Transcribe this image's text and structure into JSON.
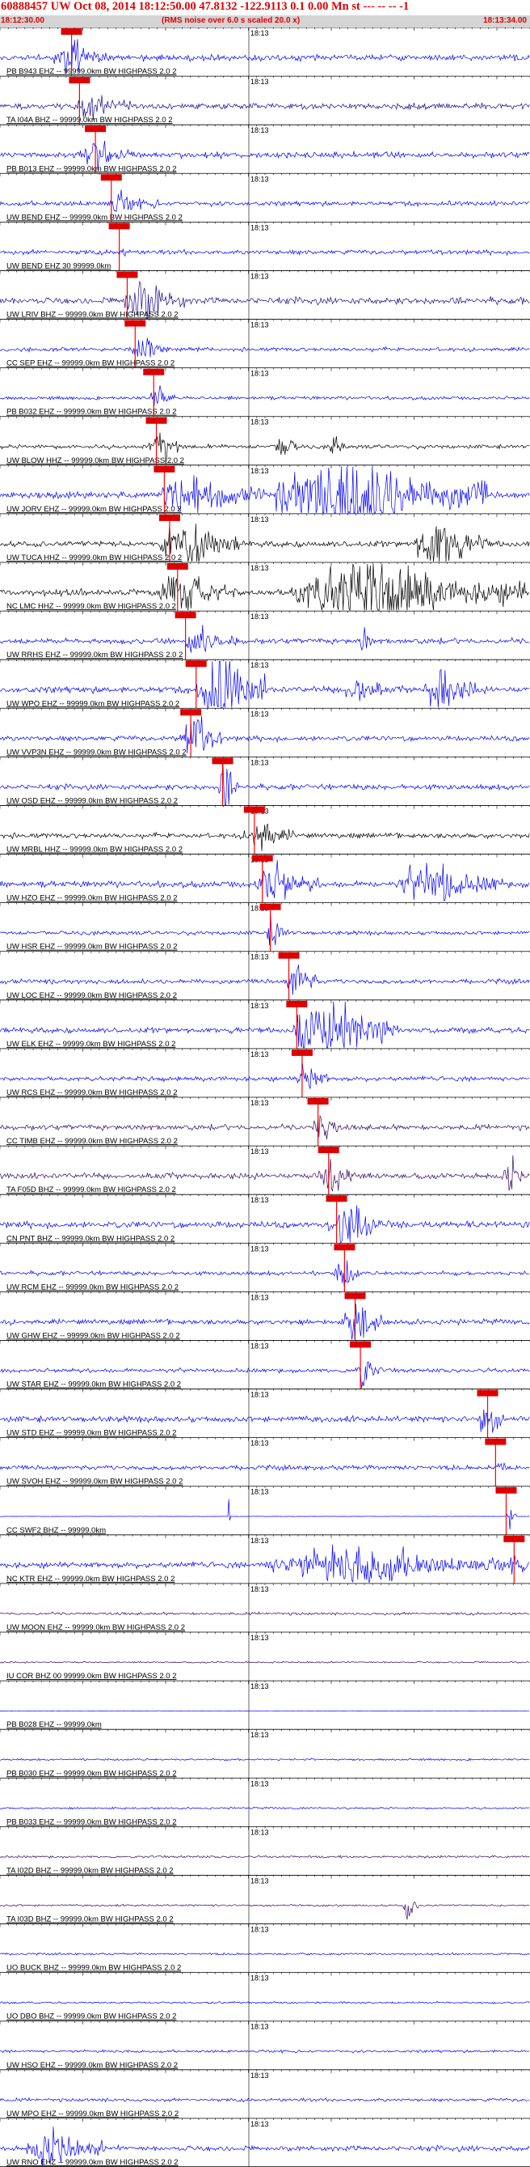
{
  "header": {
    "title": "60888457 UW Oct 08, 2014 18:12:50.00   47.8132 -122.9113  0.1 0.00 Mn st --- -- -- -1",
    "start_time": "18:12:30.00",
    "note": "(RMS noise over 6.0 s scaled 20.0 x)",
    "end_time": "18:13:34.00"
  },
  "colors": {
    "title": "#e00000",
    "pick_box": "#dd0000",
    "pick_line": "#ff0000",
    "blue": "#0000ff",
    "navy": "#1a0a8c",
    "black": "#000000",
    "purple": "#330a66",
    "subbar": "#d4d4d4"
  },
  "chart_data": {
    "type": "line",
    "title": "60888457 UW Oct 08, 2014 18:12:50.00   47.8132 -122.9113  0.1 0.00 Mn st --- -- -- -1",
    "x_range": [
      "18:12:30.00",
      "18:13:34.00"
    ],
    "minute_mark": "18:13",
    "traces": [
      {
        "label": "PB B943 EHZ -- 99999.0km BW  HIGHPASS  2.0  2",
        "color": "blue",
        "pick": 0.135,
        "amp": 0.9,
        "envelope": [
          [
            0.1,
            0.2,
            1.0
          ]
        ]
      },
      {
        "label": "TA I04A BHZ -- 99999.0km BW  HIGHPASS  2.0  2",
        "color": "navy",
        "pick": 0.15,
        "amp": 0.9,
        "envelope": [
          [
            0.14,
            0.25,
            0.7
          ]
        ]
      },
      {
        "label": "PB B013 EHZ -- 99999.0km BW  HIGHPASS  2.0  2",
        "color": "blue",
        "pick": 0.18,
        "amp": 0.9,
        "envelope": [
          [
            0.14,
            0.25,
            0.9
          ]
        ]
      },
      {
        "label": "UW BEND EHZ -- 99999.0km BW  HIGHPASS  2.0  2",
        "color": "blue",
        "pick": 0.21,
        "amp": 0.7,
        "envelope": [
          [
            0.2,
            0.3,
            0.5
          ]
        ]
      },
      {
        "label": "UW BEND EHZ 30 99999.0km",
        "color": "blue",
        "pick": 0.225,
        "amp": 0.7,
        "envelope": []
      },
      {
        "label": "UW LRIV BHZ -- 99999.0km BW  HIGHPASS  2.0  2",
        "color": "navy",
        "pick": 0.24,
        "amp": 1.0,
        "envelope": [
          [
            0.23,
            0.35,
            1.6
          ]
        ]
      },
      {
        "label": "CC SEP EHZ -- 99999.0km BW  HIGHPASS  2.0  2",
        "color": "blue",
        "pick": 0.255,
        "amp": 0.6,
        "envelope": [
          [
            0.25,
            0.32,
            0.8
          ]
        ]
      },
      {
        "label": "PB B032 EHZ -- 99999.0km BW  HIGHPASS  2.0  2",
        "color": "blue",
        "pick": 0.29,
        "amp": 0.5,
        "envelope": [
          [
            0.28,
            0.33,
            0.7
          ]
        ]
      },
      {
        "label": "UW BLOW HHZ -- 99999.0km BW  HIGHPASS  2.0  2",
        "color": "black",
        "pick": 0.295,
        "amp": 0.6,
        "envelope": [
          [
            0.28,
            0.34,
            1.0
          ],
          [
            0.52,
            0.56,
            1.2
          ],
          [
            0.62,
            0.65,
            0.8
          ]
        ]
      },
      {
        "label": "UW JORV EHZ -- 99999.0km BW  HIGHPASS  2.0  2",
        "color": "blue",
        "pick": 0.31,
        "amp": 1.0,
        "envelope": [
          [
            0.3,
            0.5,
            1.4
          ],
          [
            0.52,
            0.92,
            3.2
          ]
        ]
      },
      {
        "label": "UW TUCA HHZ -- 99999.0km BW  HIGHPASS  2.0  2",
        "color": "black",
        "pick": 0.32,
        "amp": 0.9,
        "envelope": [
          [
            0.3,
            0.45,
            1.4
          ],
          [
            0.78,
            0.92,
            1.8
          ]
        ]
      },
      {
        "label": "NC LMC HHZ -- 99999.0km BW  HIGHPASS  2.0  2",
        "color": "black",
        "pick": 0.335,
        "amp": 1.0,
        "envelope": [
          [
            0.3,
            0.45,
            1.2
          ],
          [
            0.55,
            0.99,
            2.4
          ]
        ]
      },
      {
        "label": "UW RRHS EHZ -- 99999.0km BW  HIGHPASS  2.0  2",
        "color": "blue",
        "pick": 0.35,
        "amp": 0.8,
        "envelope": [
          [
            0.35,
            0.45,
            1.0
          ],
          [
            0.68,
            0.7,
            1.2
          ]
        ]
      },
      {
        "label": "UW WPO EHZ -- 99999.0km BW  HIGHPASS  2.0  2",
        "color": "blue",
        "pick": 0.37,
        "amp": 1.0,
        "envelope": [
          [
            0.37,
            0.5,
            3.0
          ],
          [
            0.65,
            0.72,
            1.4
          ],
          [
            0.8,
            0.9,
            1.6
          ]
        ]
      },
      {
        "label": "UW VVP3N EHZ -- 99999.0km BW  HIGHPASS  2.0  2",
        "color": "blue",
        "pick": 0.36,
        "amp": 0.8,
        "envelope": [
          [
            0.34,
            0.42,
            1.6
          ]
        ]
      },
      {
        "label": "UW OSD EHZ -- 99999.0km BW  HIGHPASS  2.0  2",
        "color": "blue",
        "pick": 0.42,
        "amp": 0.8,
        "envelope": [
          [
            0.41,
            0.45,
            1.4
          ]
        ]
      },
      {
        "label": "UW MRBL HHZ -- 99999.0km BW  HIGHPASS  2.0  2",
        "color": "black",
        "pick": 0.48,
        "amp": 0.8,
        "envelope": [
          [
            0.46,
            0.56,
            1.0
          ]
        ]
      },
      {
        "label": "UW HZO EHZ -- 99999.0km BW  HIGHPASS  2.0  2",
        "color": "blue",
        "pick": 0.495,
        "amp": 0.9,
        "envelope": [
          [
            0.48,
            0.6,
            1.2
          ],
          [
            0.75,
            0.95,
            1.4
          ]
        ]
      },
      {
        "label": "UW HSR EHZ -- 99999.0km BW  HIGHPASS  2.0  2",
        "color": "blue",
        "pick": 0.51,
        "amp": 0.6,
        "envelope": [
          [
            0.5,
            0.55,
            0.8
          ]
        ]
      },
      {
        "label": "UW LOC EHZ -- 99999.0km BW  HIGHPASS  2.0  2",
        "color": "blue",
        "pick": 0.545,
        "amp": 0.7,
        "envelope": [
          [
            0.54,
            0.6,
            1.4
          ]
        ]
      },
      {
        "label": "UW ELK EHZ -- 99999.0km BW  HIGHPASS  2.0  2",
        "color": "blue",
        "pick": 0.56,
        "amp": 0.8,
        "envelope": [
          [
            0.55,
            0.75,
            2.4
          ]
        ]
      },
      {
        "label": "UW RCS EHZ -- 99999.0km BW  HIGHPASS  2.0  2",
        "color": "blue",
        "pick": 0.57,
        "amp": 0.7,
        "envelope": [
          [
            0.56,
            0.62,
            1.0
          ]
        ]
      },
      {
        "label": "CC TIMB EHZ -- 99999.0km BW  HIGHPASS  2.0  2",
        "color": "purple",
        "pick": 0.6,
        "amp": 0.8,
        "envelope": [
          [
            0.59,
            0.64,
            1.4
          ]
        ]
      },
      {
        "label": "TA F05D BHZ -- 99999.0km BW  HIGHPASS  2.0  2",
        "color": "purple",
        "pick": 0.62,
        "amp": 0.9,
        "envelope": [
          [
            0.6,
            0.67,
            1.4
          ],
          [
            0.95,
            0.99,
            1.2
          ]
        ]
      },
      {
        "label": "CN PNT BHZ -- 99999.0km BW  HIGHPASS  2.0  2",
        "color": "blue",
        "pick": 0.635,
        "amp": 1.0,
        "envelope": [
          [
            0.62,
            0.72,
            1.6
          ]
        ]
      },
      {
        "label": "UW RCM EHZ -- 99999.0km BW  HIGHPASS  2.0  2",
        "color": "blue",
        "pick": 0.65,
        "amp": 0.6,
        "envelope": [
          [
            0.63,
            0.68,
            0.9
          ]
        ]
      },
      {
        "label": "UW GHW EHZ -- 99999.0km BW  HIGHPASS  2.0  2",
        "color": "blue",
        "pick": 0.67,
        "amp": 0.8,
        "envelope": [
          [
            0.65,
            0.72,
            1.8
          ]
        ]
      },
      {
        "label": "UW STAR EHZ -- 99999.0km BW  HIGHPASS  2.0  2",
        "color": "blue",
        "pick": 0.68,
        "amp": 0.6,
        "envelope": [
          [
            0.67,
            0.72,
            0.9
          ]
        ]
      },
      {
        "label": "UW STD EHZ -- 99999.0km BW  HIGHPASS  2.0  2",
        "color": "blue",
        "pick": 0.92,
        "amp": 0.9,
        "envelope": [
          [
            0.9,
            0.95,
            1.2
          ]
        ]
      },
      {
        "label": "UW SVOH EHZ -- 99999.0km BW  HIGHPASS  2.0  2",
        "color": "blue",
        "pick": 0.935,
        "amp": 0.7,
        "envelope": []
      },
      {
        "label": "CC SWF2 BHZ -- 99999.0km",
        "color": "blue",
        "pick": 0.955,
        "amp": 0.05,
        "envelope": [
          [
            0.43,
            0.435,
            2.0
          ],
          [
            0.96,
            0.965,
            2.0
          ]
        ]
      },
      {
        "label": "NC KTR EHZ -- 99999.0km BW  HIGHPASS  2.0  2",
        "color": "blue",
        "pick": 0.97,
        "amp": 0.9,
        "envelope": [
          [
            0.5,
            0.99,
            1.2
          ]
        ]
      },
      {
        "label": "UW MOON EHZ -- 99999.0km BW  HIGHPASS  2.0  2",
        "color": "purple",
        "pick": null,
        "amp": 0.4,
        "envelope": []
      },
      {
        "label": "IU COR BHZ 00 99999.0km BW  HIGHPASS  2.0  2",
        "color": "purple",
        "pick": null,
        "amp": 0.25,
        "envelope": []
      },
      {
        "label": "PB B028 EHZ -- 99999.0km",
        "color": "blue",
        "pick": null,
        "amp": 0.05,
        "envelope": []
      },
      {
        "label": "PB B030 EHZ -- 99999.0km BW  HIGHPASS  2.0  2",
        "color": "blue",
        "pick": null,
        "amp": 0.3,
        "envelope": []
      },
      {
        "label": "PB B033 EHZ -- 99999.0km BW  HIGHPASS  2.0  2",
        "color": "blue",
        "pick": null,
        "amp": 0.3,
        "envelope": []
      },
      {
        "label": "TA I02D BHZ -- 99999.0km BW  HIGHPASS  2.0  2",
        "color": "purple",
        "pick": null,
        "amp": 0.35,
        "envelope": []
      },
      {
        "label": "TA I03D BHZ -- 99999.0km BW  HIGHPASS  2.0  2",
        "color": "purple",
        "pick": null,
        "amp": 0.3,
        "envelope": [
          [
            0.76,
            0.79,
            1.0
          ]
        ]
      },
      {
        "label": "UO BUCK BHZ -- 99999.0km BW  HIGHPASS  2.0  2",
        "color": "blue",
        "pick": null,
        "amp": 0.3,
        "envelope": []
      },
      {
        "label": "UO DBO BHZ -- 99999.0km BW  HIGHPASS  2.0  2",
        "color": "blue",
        "pick": null,
        "amp": 0.3,
        "envelope": []
      },
      {
        "label": "UW HSO EHZ -- 99999.0km BW  HIGHPASS  2.0  2",
        "color": "blue",
        "pick": null,
        "amp": 0.4,
        "envelope": []
      },
      {
        "label": "UW MPO EHZ -- 99999.0km BW  HIGHPASS  2.0  2",
        "color": "blue",
        "pick": null,
        "amp": 0.5,
        "envelope": []
      },
      {
        "label": "UW RNO EHZ -- 99999.0km BW  HIGHPASS  2.0  2",
        "color": "blue",
        "pick": null,
        "amp": 0.8,
        "envelope": [
          [
            0.05,
            0.2,
            1.2
          ]
        ]
      }
    ]
  }
}
